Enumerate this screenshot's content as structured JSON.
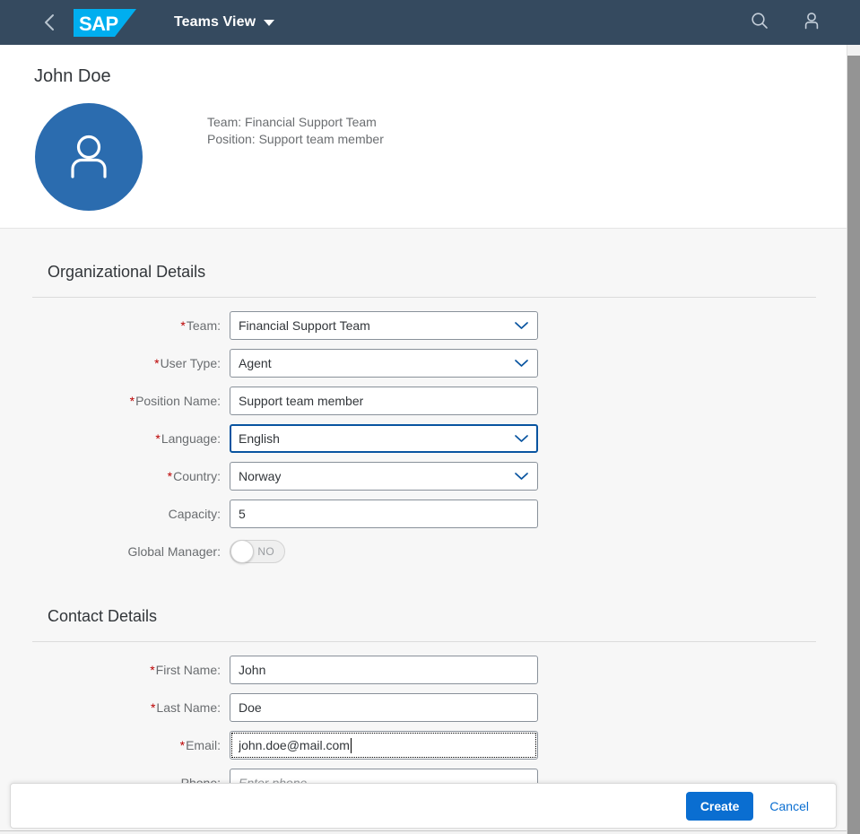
{
  "header": {
    "back_icon": "chevron-left-icon",
    "logo_text": "SAP",
    "app_title": "Teams View",
    "caret_icon": "caret-down-icon",
    "search_icon": "search-icon",
    "user_icon": "user-icon",
    "background_color": "#354a5f"
  },
  "object_header": {
    "title": "John Doe",
    "avatar_icon": "person-avatar-icon",
    "avatar_color": "#2b6caf",
    "attributes": [
      "Team: Financial Support Team",
      "Position: Support team member"
    ]
  },
  "sections": [
    {
      "title": "Organizational Details",
      "fields": [
        {
          "label": "Team:",
          "required": true,
          "type": "select",
          "value": "Financial Support Team",
          "focused": false
        },
        {
          "label": "User Type:",
          "required": true,
          "type": "select",
          "value": "Agent",
          "focused": false
        },
        {
          "label": "Position Name:",
          "required": true,
          "type": "input",
          "value": "Support team member",
          "focused": false
        },
        {
          "label": "Language:",
          "required": true,
          "type": "select",
          "value": "English",
          "focused": true
        },
        {
          "label": "Country:",
          "required": true,
          "type": "select",
          "value": "Norway",
          "focused": false
        },
        {
          "label": "Capacity:",
          "required": false,
          "type": "input",
          "value": "5",
          "focused": false
        },
        {
          "label": "Global Manager:",
          "required": false,
          "type": "switch",
          "value": "NO",
          "focused": false
        }
      ]
    },
    {
      "title": "Contact Details",
      "fields": [
        {
          "label": "First Name:",
          "required": true,
          "type": "input",
          "value": "John",
          "focused": false
        },
        {
          "label": "Last Name:",
          "required": true,
          "type": "input",
          "value": "Doe",
          "focused": false
        },
        {
          "label": "Email:",
          "required": true,
          "type": "input",
          "value": "john.doe@mail.com",
          "focused": true
        },
        {
          "label": "Phone:",
          "required": false,
          "type": "input",
          "value": "",
          "placeholder": "Enter phone ...",
          "focused": false
        }
      ]
    }
  ],
  "footer": {
    "create_label": "Create",
    "cancel_label": "Cancel",
    "create_color": "#0a6ed1"
  },
  "scrollbar": {
    "thumb_color": "#949494",
    "orientation": "vertical"
  }
}
